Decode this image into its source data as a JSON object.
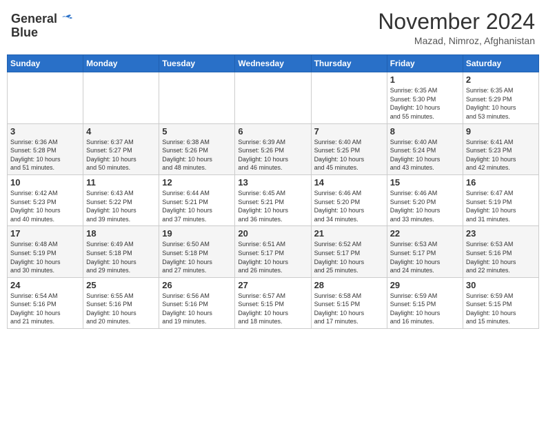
{
  "header": {
    "logo_general": "General",
    "logo_blue": "Blue",
    "month": "November 2024",
    "location": "Mazad, Nimroz, Afghanistan"
  },
  "days_of_week": [
    "Sunday",
    "Monday",
    "Tuesday",
    "Wednesday",
    "Thursday",
    "Friday",
    "Saturday"
  ],
  "weeks": [
    [
      {
        "day": "",
        "info": ""
      },
      {
        "day": "",
        "info": ""
      },
      {
        "day": "",
        "info": ""
      },
      {
        "day": "",
        "info": ""
      },
      {
        "day": "",
        "info": ""
      },
      {
        "day": "1",
        "info": "Sunrise: 6:35 AM\nSunset: 5:30 PM\nDaylight: 10 hours\nand 55 minutes."
      },
      {
        "day": "2",
        "info": "Sunrise: 6:35 AM\nSunset: 5:29 PM\nDaylight: 10 hours\nand 53 minutes."
      }
    ],
    [
      {
        "day": "3",
        "info": "Sunrise: 6:36 AM\nSunset: 5:28 PM\nDaylight: 10 hours\nand 51 minutes."
      },
      {
        "day": "4",
        "info": "Sunrise: 6:37 AM\nSunset: 5:27 PM\nDaylight: 10 hours\nand 50 minutes."
      },
      {
        "day": "5",
        "info": "Sunrise: 6:38 AM\nSunset: 5:26 PM\nDaylight: 10 hours\nand 48 minutes."
      },
      {
        "day": "6",
        "info": "Sunrise: 6:39 AM\nSunset: 5:26 PM\nDaylight: 10 hours\nand 46 minutes."
      },
      {
        "day": "7",
        "info": "Sunrise: 6:40 AM\nSunset: 5:25 PM\nDaylight: 10 hours\nand 45 minutes."
      },
      {
        "day": "8",
        "info": "Sunrise: 6:40 AM\nSunset: 5:24 PM\nDaylight: 10 hours\nand 43 minutes."
      },
      {
        "day": "9",
        "info": "Sunrise: 6:41 AM\nSunset: 5:23 PM\nDaylight: 10 hours\nand 42 minutes."
      }
    ],
    [
      {
        "day": "10",
        "info": "Sunrise: 6:42 AM\nSunset: 5:23 PM\nDaylight: 10 hours\nand 40 minutes."
      },
      {
        "day": "11",
        "info": "Sunrise: 6:43 AM\nSunset: 5:22 PM\nDaylight: 10 hours\nand 39 minutes."
      },
      {
        "day": "12",
        "info": "Sunrise: 6:44 AM\nSunset: 5:21 PM\nDaylight: 10 hours\nand 37 minutes."
      },
      {
        "day": "13",
        "info": "Sunrise: 6:45 AM\nSunset: 5:21 PM\nDaylight: 10 hours\nand 36 minutes."
      },
      {
        "day": "14",
        "info": "Sunrise: 6:46 AM\nSunset: 5:20 PM\nDaylight: 10 hours\nand 34 minutes."
      },
      {
        "day": "15",
        "info": "Sunrise: 6:46 AM\nSunset: 5:20 PM\nDaylight: 10 hours\nand 33 minutes."
      },
      {
        "day": "16",
        "info": "Sunrise: 6:47 AM\nSunset: 5:19 PM\nDaylight: 10 hours\nand 31 minutes."
      }
    ],
    [
      {
        "day": "17",
        "info": "Sunrise: 6:48 AM\nSunset: 5:19 PM\nDaylight: 10 hours\nand 30 minutes."
      },
      {
        "day": "18",
        "info": "Sunrise: 6:49 AM\nSunset: 5:18 PM\nDaylight: 10 hours\nand 29 minutes."
      },
      {
        "day": "19",
        "info": "Sunrise: 6:50 AM\nSunset: 5:18 PM\nDaylight: 10 hours\nand 27 minutes."
      },
      {
        "day": "20",
        "info": "Sunrise: 6:51 AM\nSunset: 5:17 PM\nDaylight: 10 hours\nand 26 minutes."
      },
      {
        "day": "21",
        "info": "Sunrise: 6:52 AM\nSunset: 5:17 PM\nDaylight: 10 hours\nand 25 minutes."
      },
      {
        "day": "22",
        "info": "Sunrise: 6:53 AM\nSunset: 5:17 PM\nDaylight: 10 hours\nand 24 minutes."
      },
      {
        "day": "23",
        "info": "Sunrise: 6:53 AM\nSunset: 5:16 PM\nDaylight: 10 hours\nand 22 minutes."
      }
    ],
    [
      {
        "day": "24",
        "info": "Sunrise: 6:54 AM\nSunset: 5:16 PM\nDaylight: 10 hours\nand 21 minutes."
      },
      {
        "day": "25",
        "info": "Sunrise: 6:55 AM\nSunset: 5:16 PM\nDaylight: 10 hours\nand 20 minutes."
      },
      {
        "day": "26",
        "info": "Sunrise: 6:56 AM\nSunset: 5:16 PM\nDaylight: 10 hours\nand 19 minutes."
      },
      {
        "day": "27",
        "info": "Sunrise: 6:57 AM\nSunset: 5:15 PM\nDaylight: 10 hours\nand 18 minutes."
      },
      {
        "day": "28",
        "info": "Sunrise: 6:58 AM\nSunset: 5:15 PM\nDaylight: 10 hours\nand 17 minutes."
      },
      {
        "day": "29",
        "info": "Sunrise: 6:59 AM\nSunset: 5:15 PM\nDaylight: 10 hours\nand 16 minutes."
      },
      {
        "day": "30",
        "info": "Sunrise: 6:59 AM\nSunset: 5:15 PM\nDaylight: 10 hours\nand 15 minutes."
      }
    ]
  ]
}
